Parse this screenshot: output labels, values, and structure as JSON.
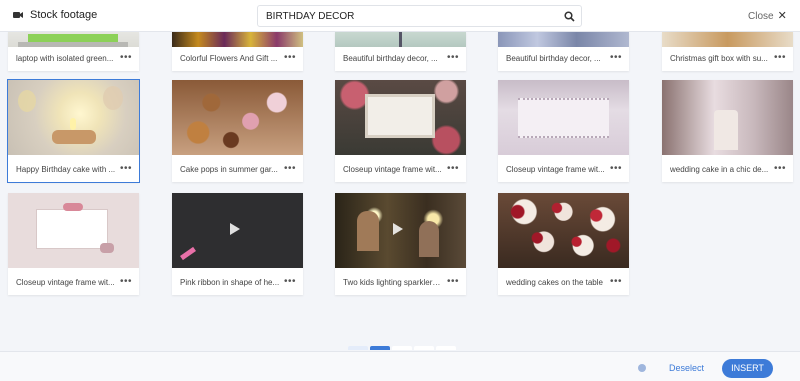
{
  "header": {
    "title": "Stock footage",
    "search_value": "BIRTHDAY DECOR",
    "close_label": "Close",
    "close_icon": "✕"
  },
  "results_top": [
    {
      "caption": "laptop with isolated green..."
    },
    {
      "caption": "Colorful Flowers And Gift ..."
    },
    {
      "caption": "Beautiful birthday decor, ..."
    },
    {
      "caption": "Beautiful birthday decor, ..."
    },
    {
      "caption": "Christmas gift box with su..."
    }
  ],
  "results_mid": [
    {
      "caption": "Happy Birthday cake with ..."
    },
    {
      "caption": "Cake pops in summer gar..."
    },
    {
      "caption": "Closeup vintage frame wit..."
    },
    {
      "caption": "Closeup vintage frame wit..."
    },
    {
      "caption": "wedding cake in a chic de..."
    }
  ],
  "results_bottom": [
    {
      "caption": "Closeup vintage frame wit..."
    },
    {
      "caption": "Pink ribbon in shape of he..."
    },
    {
      "caption": "Two kids lighting sparklers..."
    },
    {
      "caption": "wedding cakes on the table"
    }
  ],
  "more_label": "•••",
  "pagination": {
    "prev": "‹",
    "pages": [
      "1",
      "2",
      "3"
    ],
    "next": "›",
    "current": "1"
  },
  "footer": {
    "deselect_label": "Deselect",
    "insert_label": "INSERT"
  },
  "colors": {
    "accent": "#3d7bd8",
    "background": "#f3f5f9"
  }
}
